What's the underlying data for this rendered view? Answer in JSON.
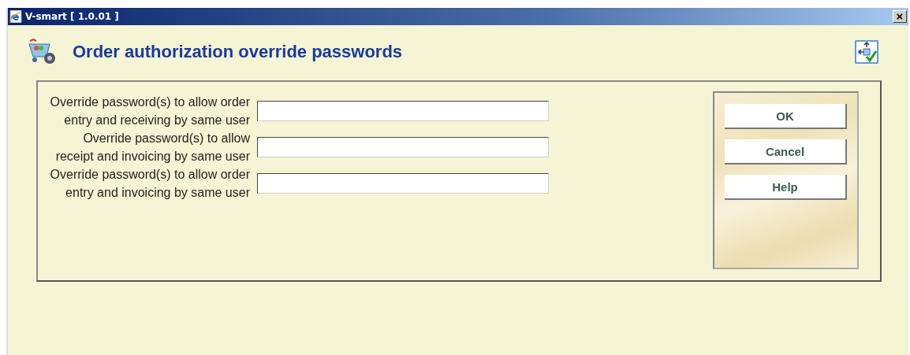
{
  "window": {
    "title": "V-smart [ 1.0.01 ]",
    "close": "×"
  },
  "page": {
    "title": "Order authorization override passwords"
  },
  "fields": [
    {
      "label": "Override password(s) to allow order entry and receiving by same user"
    },
    {
      "label": "Override password(s) to allow receipt and invoicing by same user"
    },
    {
      "label": "Override password(s) to allow order entry and invoicing by same user"
    }
  ],
  "buttons": [
    "OK",
    "Cancel",
    "Help"
  ]
}
